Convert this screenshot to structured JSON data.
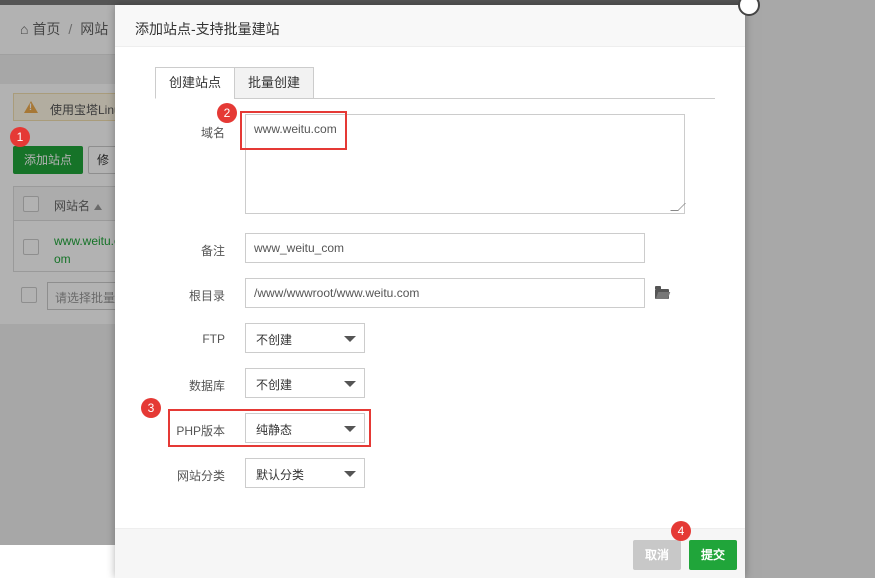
{
  "background": {
    "breadcrumb_home": "首页",
    "breadcrumb_site": "网站",
    "alert_text": "使用宝塔Linux",
    "add_site_button": "添加站点",
    "modify_button": "修改",
    "column_site_name": "网站名",
    "site_row": "www.weitu.com",
    "batch_select_placeholder": "请选择批量操作"
  },
  "dialog": {
    "title": "添加站点-支持批量建站",
    "tabs": [
      {
        "label": "创建站点",
        "active": true
      },
      {
        "label": "批量创建",
        "active": false
      }
    ],
    "domain_label": "域名",
    "domain_value": "www.weitu.com",
    "note_label": "备注",
    "note_value": "www_weitu_com",
    "root_label": "根目录",
    "root_value": "/www/wwwroot/www.weitu.com",
    "ftp_label": "FTP",
    "ftp_value": "不创建",
    "db_label": "数据库",
    "db_value": "不创建",
    "php_label": "PHP版本",
    "php_value": "纯静态",
    "category_label": "网站分类",
    "category_value": "默认分类",
    "cancel_button": "取消",
    "submit_button": "提交"
  },
  "annotations": {
    "step1": "1",
    "step2": "2",
    "step3": "3",
    "step4": "4",
    "marker_color": "#e53935"
  },
  "colors": {
    "primary_green": "#20a53a",
    "link_green": "#20a53a"
  }
}
